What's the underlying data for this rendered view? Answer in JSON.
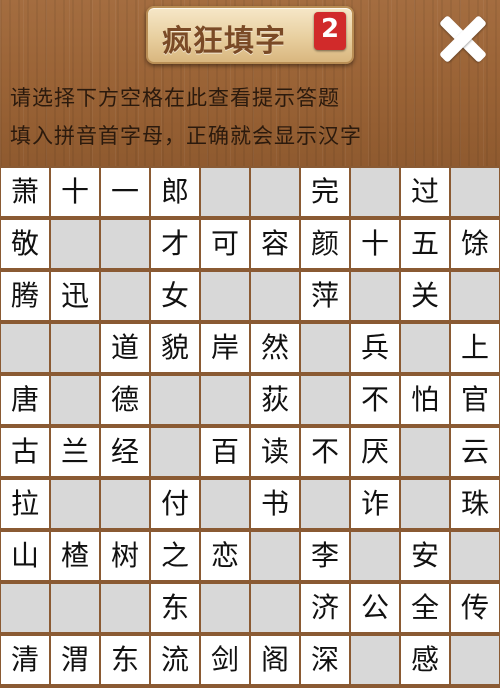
{
  "header": {
    "title": "疯狂填字",
    "level_badge": "2",
    "close_icon": "close-icon"
  },
  "hints": {
    "line1": "请选择下方空格在此查看提示答题",
    "line2": "填入拼音首字母，正确就会显示汉字"
  },
  "colors": {
    "wood": "#9a6336",
    "cell_filled": "#ffffff",
    "cell_blank": "#d8d8d8",
    "badge": "#d12a2a"
  },
  "grid": [
    [
      "萧",
      "十",
      "一",
      "郎",
      "",
      "",
      "完",
      "",
      "过",
      ""
    ],
    [
      "敬",
      "",
      "",
      "才",
      "可",
      "容",
      "颜",
      "十",
      "五",
      "馀"
    ],
    [
      "腾",
      "迅",
      "",
      "女",
      "",
      "",
      "萍",
      "",
      "关",
      ""
    ],
    [
      "",
      "",
      "道",
      "貌",
      "岸",
      "然",
      "",
      "兵",
      "",
      "上"
    ],
    [
      "唐",
      "",
      "德",
      "",
      "",
      "荻",
      "",
      "不",
      "怕",
      "官"
    ],
    [
      "古",
      "兰",
      "经",
      "",
      "百",
      "读",
      "不",
      "厌",
      "",
      "云"
    ],
    [
      "拉",
      "",
      "",
      "付",
      "",
      "书",
      "",
      "诈",
      "",
      "珠"
    ],
    [
      "山",
      "楂",
      "树",
      "之",
      "恋",
      "",
      "李",
      "",
      "安",
      ""
    ],
    [
      "",
      "",
      "",
      "东",
      "",
      "",
      "济",
      "公",
      "全",
      "传"
    ],
    [
      "清",
      "渭",
      "东",
      "流",
      "剑",
      "阁",
      "深",
      "",
      "感",
      ""
    ]
  ]
}
